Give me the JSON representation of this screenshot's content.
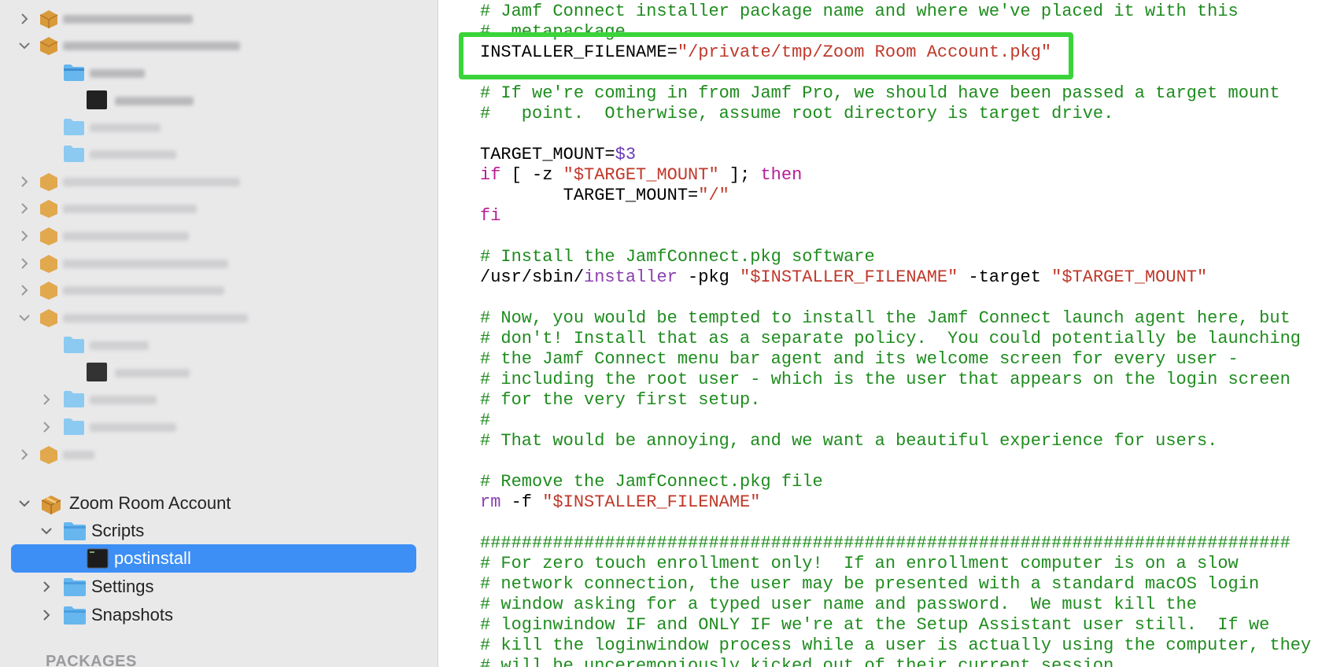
{
  "sidebar": {
    "project": {
      "label": "Zoom Room Account",
      "children": [
        {
          "label": "Scripts",
          "children": [
            {
              "label": "postinstall",
              "selected": true
            }
          ]
        },
        {
          "label": "Settings"
        },
        {
          "label": "Snapshots"
        }
      ]
    },
    "section_header": "PACKAGES"
  },
  "editor": {
    "lines": [
      [
        {
          "t": "# Jamf Connect installer package name and where we've placed it with this",
          "c": "cm"
        }
      ],
      [
        {
          "t": "#  metapackage",
          "c": "cm"
        }
      ],
      [
        {
          "t": "INSTALLER_FILENAME=",
          "c": ""
        },
        {
          "t": "\"/private/tmp/Zoom Room Account.pkg\"",
          "c": "str"
        }
      ],
      [],
      [
        {
          "t": "# If we're coming in from Jamf Pro, we should have been passed a target mount",
          "c": "cm"
        }
      ],
      [
        {
          "t": "#   point.  Otherwise, assume root directory is target drive.",
          "c": "cm"
        }
      ],
      [],
      [
        {
          "t": "TARGET_MOUNT=",
          "c": ""
        },
        {
          "t": "$3",
          "c": "var"
        }
      ],
      [
        {
          "t": "if",
          "c": "kw"
        },
        {
          "t": " [ -z ",
          "c": ""
        },
        {
          "t": "\"$TARGET_MOUNT\"",
          "c": "str"
        },
        {
          "t": " ]; ",
          "c": ""
        },
        {
          "t": "then",
          "c": "kw"
        }
      ],
      [
        {
          "t": "        TARGET_MOUNT=",
          "c": ""
        },
        {
          "t": "\"/\"",
          "c": "str"
        }
      ],
      [
        {
          "t": "fi",
          "c": "kw"
        }
      ],
      [],
      [
        {
          "t": "# Install the JamfConnect.pkg software",
          "c": "cm"
        }
      ],
      [
        {
          "t": "/usr/sbin/",
          "c": ""
        },
        {
          "t": "installer",
          "c": "cmd"
        },
        {
          "t": " -pkg ",
          "c": ""
        },
        {
          "t": "\"$INSTALLER_FILENAME\"",
          "c": "str"
        },
        {
          "t": " -target ",
          "c": ""
        },
        {
          "t": "\"$TARGET_MOUNT\"",
          "c": "str"
        }
      ],
      [],
      [
        {
          "t": "# Now, you would be tempted to install the Jamf Connect launch agent here, but",
          "c": "cm"
        }
      ],
      [
        {
          "t": "# don't! Install that as a separate policy.  You could potentially be launching",
          "c": "cm"
        }
      ],
      [
        {
          "t": "# the Jamf Connect menu bar agent and its welcome screen for every user -",
          "c": "cm"
        }
      ],
      [
        {
          "t": "# including the root user - which is the user that appears on the login screen",
          "c": "cm"
        }
      ],
      [
        {
          "t": "# for the very first setup.",
          "c": "cm"
        }
      ],
      [
        {
          "t": "#",
          "c": "cm"
        }
      ],
      [
        {
          "t": "# That would be annoying, and we want a beautiful experience for users.",
          "c": "cm"
        }
      ],
      [],
      [
        {
          "t": "# Remove the JamfConnect.pkg file",
          "c": "cm"
        }
      ],
      [
        {
          "t": "rm",
          "c": "cmd"
        },
        {
          "t": " -f ",
          "c": ""
        },
        {
          "t": "\"$INSTALLER_FILENAME\"",
          "c": "str"
        }
      ],
      [],
      [
        {
          "t": "##############################################################################",
          "c": "cm"
        }
      ],
      [
        {
          "t": "# For zero touch enrollment only!  If an enrollment computer is on a slow",
          "c": "cm"
        }
      ],
      [
        {
          "t": "# network connection, the user may be presented with a standard macOS login",
          "c": "cm"
        }
      ],
      [
        {
          "t": "# window asking for a typed user name and password.  We must kill the",
          "c": "cm"
        }
      ],
      [
        {
          "t": "# loginwindow IF and ONLY IF we're at the Setup Assistant user still.  If we",
          "c": "cm"
        }
      ],
      [
        {
          "t": "# kill the loginwindow process while a user is actually using the computer, they",
          "c": "cm"
        }
      ],
      [
        {
          "t": "# will be unceremoniously kicked out of their current session.",
          "c": "cm"
        }
      ]
    ]
  },
  "colors": {
    "selection": "#3d8ff5",
    "highlight_box": "#3ad43a",
    "comment": "#1f8c1f",
    "string": "#c0392b",
    "keyword": "#b71d94"
  }
}
